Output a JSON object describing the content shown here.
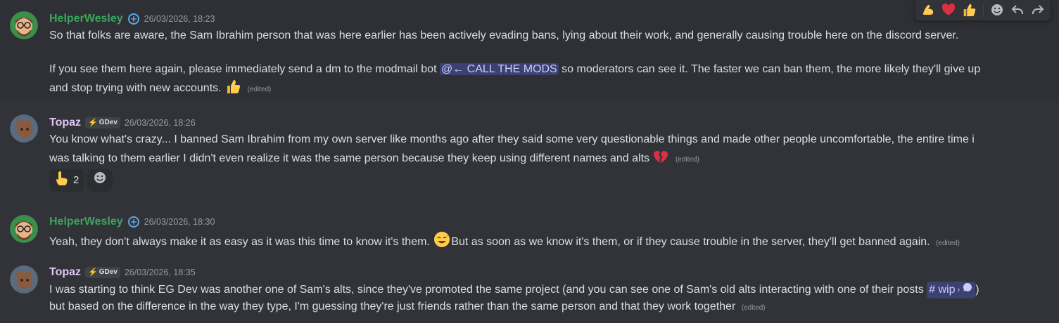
{
  "toolbar": {
    "reactions": [
      "flexed-biceps",
      "red-heart",
      "thumbs-up"
    ],
    "actions": [
      "add-reaction",
      "reply",
      "forward"
    ]
  },
  "messages": [
    {
      "username": "HelperWesley",
      "timestamp": "26/03/2026, 18:23",
      "line1": "So that folks are aware, the Sam Ibrahim person that was here earlier has been actively evading bans, lying about their work, and generally causing trouble here on the discord server.",
      "line2a": "If you see them here again, please immediately send a dm to the modmail bot",
      "mention": "@← CALL THE MODS",
      "line2b": "so moderators can see it. The faster we can ban them, the more likely they'll give up",
      "line3": "and stop trying with new accounts.",
      "edited": "(edited)"
    },
    {
      "username": "Topaz",
      "tag": "GDev",
      "timestamp": "26/03/2026, 18:26",
      "line1": "You know what's crazy... I banned Sam Ibrahim from my own server like months ago after they said some very questionable things and made other people uncomfortable, the entire time i",
      "line2": "was talking to them earlier I didn't even realize it was the same person  because they keep using different names and alts",
      "edited": "(edited)",
      "reaction_count": "2"
    },
    {
      "username": "HelperWesley",
      "timestamp": "26/03/2026, 18:30",
      "line1a": "Yeah, they don't always make it as easy as it was this time to know it's them.",
      "line1b": "But as soon as we know it's them, or if they cause trouble in the server, they'll get banned again.",
      "edited": "(edited)"
    },
    {
      "username": "Topaz",
      "tag": "GDev",
      "timestamp": "26/03/2026, 18:35",
      "line1a": "I was starting to think EG Dev was another one of Sam's alts, since they've promoted the same project (and you can see one of Sam's old alts interacting with one of their posts",
      "channel": "# wip",
      "line1b": ")",
      "line2": "but based on the difference in the way they type, I'm guessing they're just friends rather than the same person and that they work together",
      "edited": "(edited)"
    }
  ]
}
